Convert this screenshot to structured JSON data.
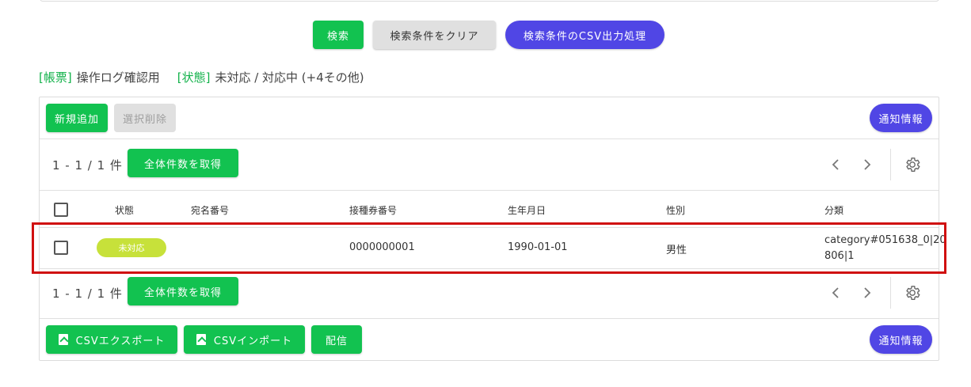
{
  "search": {
    "search_label": "検索",
    "clear_label": "検索条件をクリア",
    "csv_label": "検索条件のCSV出力処理"
  },
  "criteria": [
    {
      "key": "[帳票]",
      "value": "操作ログ確認用"
    },
    {
      "key": "[状態]",
      "value": "未対応 / 対応中 (+4その他)"
    }
  ],
  "toolbar": {
    "add_label": "新規追加",
    "delete_label": "選択削除",
    "notify_label": "通知情報"
  },
  "pagination": {
    "count_text": "1 - 1 / 1 件",
    "get_total_label": "全体件数を取得"
  },
  "table": {
    "headers": [
      "状態",
      "宛名番号",
      "接種券番号",
      "生年月日",
      "性別",
      "分類"
    ],
    "rows": [
      {
        "status": "未対応",
        "address_no": "",
        "ticket_no": "0000000001",
        "birthdate": "1990-01-01",
        "gender": "男性",
        "category_line1": "category#051638_0|20",
        "category_line2": "806|1"
      }
    ]
  },
  "footer": {
    "csv_export_label": "CSVエクスポート",
    "csv_import_label": "CSVインポート",
    "deliver_label": "配信",
    "notify_label": "通知情報"
  },
  "colors": {
    "green": "#12c250",
    "purple": "#5046e5",
    "chip": "#c7e13a",
    "highlight": "#d01010"
  }
}
